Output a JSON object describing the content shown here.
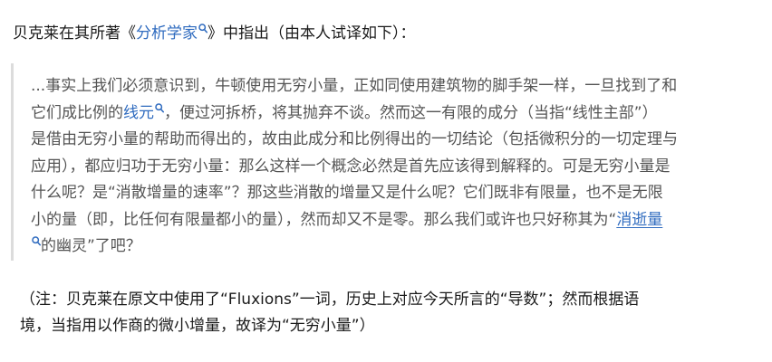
{
  "intro": {
    "before": "贝克莱在其所著《",
    "link": "分析学家",
    "after": "》中指出（由本人试译如下）："
  },
  "quote": {
    "line1": "...事实上我们必须意识到，牛顿使用无穷小量，正如同使用建筑物的脚手架一样，一旦找到了和",
    "line2_before": "它们成比例的",
    "line2_link": "线元",
    "line2_after": "，便过河拆桥，将其抛弃不谈。然而这一有限的成分（当指“线性主部”）",
    "line3": "是借由无穷小量的帮助而得出的，故由此成分和比例得出的一切结论（包括微积分的一切定理与",
    "line4": "应用），都应归功于无穷小量：那么这样一个概念必然是首先应该得到解释的。可是无穷小量是",
    "line5": "什么呢？是“消散增量的速率”？那这些消散的增量又是什么呢？它们既非有限量，也不是无限",
    "line6_before": "小的量（即，比任何有限量都小的量），然而却又不是零。那么我们或许也只好称其为“",
    "line6_link": "消逝量",
    "line7_after": "的幽灵”了吧？"
  },
  "note": {
    "line1": "（注：贝克莱在原文中使用了“Fluxions”一词，历史上对应今天所言的“导数”；然而根据语",
    "line2": "境，当指用以作商的微小增量，故译为“无穷小量”）"
  },
  "colors": {
    "link": "#2f6bbf",
    "quote_text": "#545454",
    "quote_border": "#dcdcdc",
    "body_text": "#1a1a1a"
  },
  "icons": {
    "link_suffix": "search-icon"
  }
}
